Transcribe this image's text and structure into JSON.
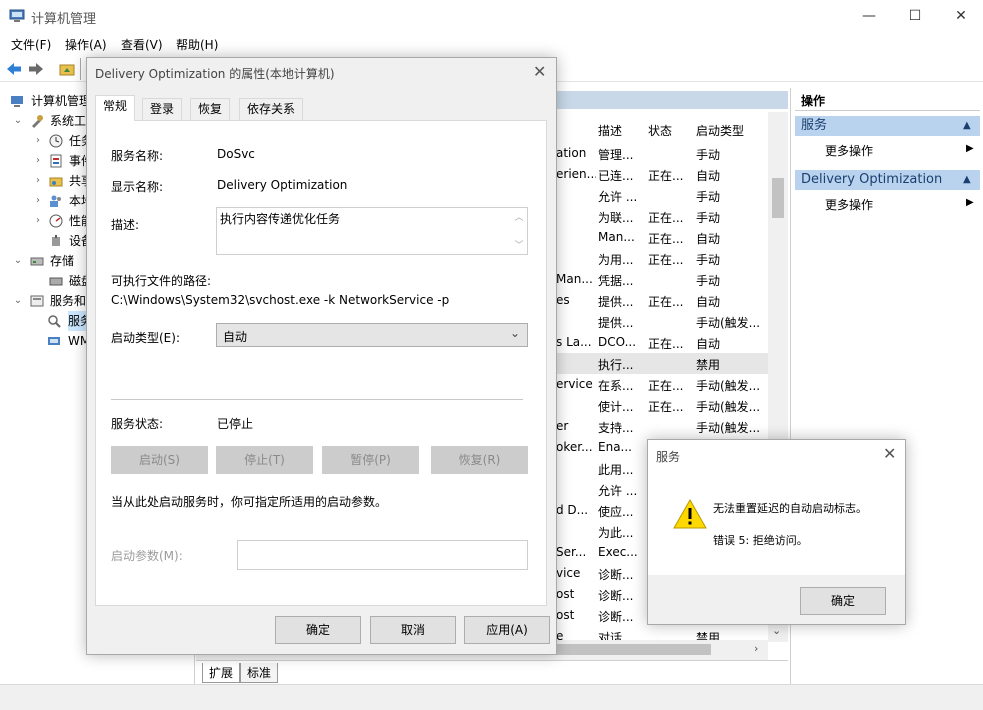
{
  "window": {
    "title": "计算机管理",
    "minimize": "—",
    "maximize": "☐",
    "close": "✕"
  },
  "menu": [
    "文件(F)",
    "操作(A)",
    "查看(V)",
    "帮助(H)"
  ],
  "tree": {
    "items": [
      {
        "label": "计算机管理",
        "expander": ""
      },
      {
        "label": "系统工",
        "expander": "⌄"
      },
      {
        "label": "任务",
        "expander": "›"
      },
      {
        "label": "事件",
        "expander": "›"
      },
      {
        "label": "共享",
        "expander": "›"
      },
      {
        "label": "本地",
        "expander": "›"
      },
      {
        "label": "性能",
        "expander": "›"
      },
      {
        "label": "设备",
        "expander": ""
      },
      {
        "label": "存储",
        "expander": "⌄"
      },
      {
        "label": "磁盘",
        "expander": ""
      },
      {
        "label": "服务和",
        "expander": "⌄"
      },
      {
        "label": "服务",
        "expander": ""
      },
      {
        "label": "WMI",
        "expander": ""
      }
    ]
  },
  "services": {
    "columns": {
      "desc": "描述",
      "status": "状态",
      "startup": "启动类型"
    },
    "rows": [
      {
        "name": "ation",
        "desc": "管理...",
        "status": "",
        "startup": "手动"
      },
      {
        "name": "erien...",
        "desc": "已连...",
        "status": "正在...",
        "startup": "自动"
      },
      {
        "name": "",
        "desc": "允许 ...",
        "status": "",
        "startup": "手动"
      },
      {
        "name": "",
        "desc": "为联...",
        "status": "正在...",
        "startup": "手动"
      },
      {
        "name": "",
        "desc": "Man...",
        "status": "正在...",
        "startup": "自动"
      },
      {
        "name": "",
        "desc": "为用...",
        "status": "正在...",
        "startup": "手动"
      },
      {
        "name": "Man...",
        "desc": "凭据...",
        "status": "",
        "startup": "手动"
      },
      {
        "name": "es",
        "desc": "提供...",
        "status": "正在...",
        "startup": "自动"
      },
      {
        "name": "",
        "desc": "提供...",
        "status": "",
        "startup": "手动(触发..."
      },
      {
        "name": "s La...",
        "desc": "DCO...",
        "status": "正在...",
        "startup": "自动"
      },
      {
        "name": "",
        "desc": "执行...",
        "status": "",
        "startup": "禁用"
      },
      {
        "name": "ervice",
        "desc": "在系...",
        "status": "正在...",
        "startup": "手动(触发..."
      },
      {
        "name": "",
        "desc": "使计...",
        "status": "正在...",
        "startup": "手动(触发..."
      },
      {
        "name": "er",
        "desc": "支持...",
        "status": "",
        "startup": "手动(触发..."
      },
      {
        "name": "oker...",
        "desc": "Ena...",
        "status": "",
        "startup": ""
      },
      {
        "name": "",
        "desc": "此用...",
        "status": "",
        "startup": ""
      },
      {
        "name": "",
        "desc": "允许 ...",
        "status": "",
        "startup": ""
      },
      {
        "name": "d D...",
        "desc": "使应...",
        "status": "",
        "startup": ""
      },
      {
        "name": "",
        "desc": "为此...",
        "status": "",
        "startup": ""
      },
      {
        "name": "Ser...",
        "desc": "Exec...",
        "status": "",
        "startup": ""
      },
      {
        "name": "vice",
        "desc": "诊断...",
        "status": "",
        "startup": ""
      },
      {
        "name": "ost",
        "desc": "诊断...",
        "status": "",
        "startup": ""
      },
      {
        "name": "ost",
        "desc": "诊断...",
        "status": "",
        "startup": ""
      },
      {
        "name": "e",
        "desc": "对话...",
        "status": "",
        "startup": "禁用"
      }
    ],
    "bottom_tabs": [
      "扩展",
      "标准"
    ]
  },
  "actions": {
    "header": "操作",
    "section1": "服务",
    "section2": "Delivery Optimization",
    "more": "更多操作",
    "collapse_glyph": "▲",
    "arrow_glyph": "▶"
  },
  "props": {
    "title": "Delivery Optimization 的属性(本地计算机)",
    "tabs": [
      "常规",
      "登录",
      "恢复",
      "依存关系"
    ],
    "service_name_label": "服务名称:",
    "service_name": "DoSvc",
    "display_name_label": "显示名称:",
    "display_name": "Delivery Optimization",
    "description_label": "描述:",
    "description": "执行内容传递优化任务",
    "path_label": "可执行文件的路径:",
    "path": "C:\\Windows\\System32\\svchost.exe -k NetworkService -p",
    "startup_type_label": "启动类型(E):",
    "startup_type": "自动",
    "status_label": "服务状态:",
    "status": "已停止",
    "buttons": {
      "start": "启动(S)",
      "stop": "停止(T)",
      "pause": "暂停(P)",
      "resume": "恢复(R)"
    },
    "hint": "当从此处启动服务时，你可指定所适用的启动参数。",
    "param_label": "启动参数(M):",
    "param_value": "",
    "ok": "确定",
    "cancel": "取消",
    "apply": "应用(A)"
  },
  "msgbox": {
    "title": "服务",
    "line1": "无法重置延迟的自动启动标志。",
    "line2": "错误 5: 拒绝访问。",
    "ok": "确定"
  },
  "colors": {
    "selection": "#cce8ff",
    "header_band": "#c8d8e8",
    "actions_band": "#b9d3ee",
    "warning": "#ffd800"
  }
}
